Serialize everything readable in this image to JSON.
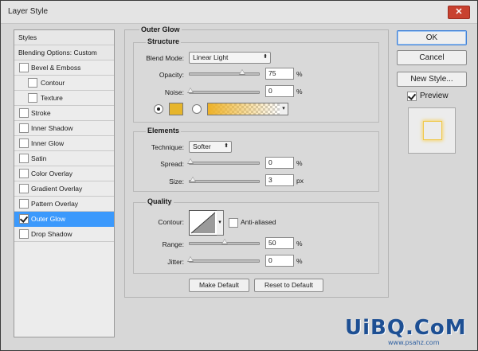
{
  "window": {
    "title": "Layer Style",
    "close_glyph": "✕"
  },
  "styles": {
    "header": "Styles",
    "blending": "Blending Options: Custom",
    "items": [
      {
        "label": "Bevel & Emboss",
        "checked": false
      },
      {
        "label": "Contour",
        "checked": false
      },
      {
        "label": "Texture",
        "checked": false
      },
      {
        "label": "Stroke",
        "checked": false
      },
      {
        "label": "Inner Shadow",
        "checked": false
      },
      {
        "label": "Inner Glow",
        "checked": false
      },
      {
        "label": "Satin",
        "checked": false
      },
      {
        "label": "Color Overlay",
        "checked": false
      },
      {
        "label": "Gradient Overlay",
        "checked": false
      },
      {
        "label": "Pattern Overlay",
        "checked": false
      },
      {
        "label": "Outer Glow",
        "checked": true
      },
      {
        "label": "Drop Shadow",
        "checked": false
      }
    ]
  },
  "outer_glow": {
    "title": "Outer Glow",
    "structure": {
      "title": "Structure",
      "blend_mode_label": "Blend Mode:",
      "blend_mode_value": "Linear Light",
      "opacity_label": "Opacity:",
      "opacity_value": "75",
      "noise_label": "Noise:",
      "noise_value": "0",
      "percent": "%",
      "glow_color": "#e6b52b"
    },
    "elements": {
      "title": "Elements",
      "technique_label": "Technique:",
      "technique_value": "Softer",
      "spread_label": "Spread:",
      "spread_value": "0",
      "size_label": "Size:",
      "size_value": "3",
      "px": "px"
    },
    "quality": {
      "title": "Quality",
      "contour_label": "Contour:",
      "anti_aliased_label": "Anti-aliased",
      "range_label": "Range:",
      "range_value": "50",
      "jitter_label": "Jitter:",
      "jitter_value": "0"
    },
    "make_default": "Make Default",
    "reset_default": "Reset to Default"
  },
  "buttons": {
    "ok": "OK",
    "cancel": "Cancel",
    "new_style": "New Style...",
    "preview": "Preview"
  },
  "watermark": {
    "main": "UiBQ.CoM",
    "small": "www.psahz.com"
  }
}
